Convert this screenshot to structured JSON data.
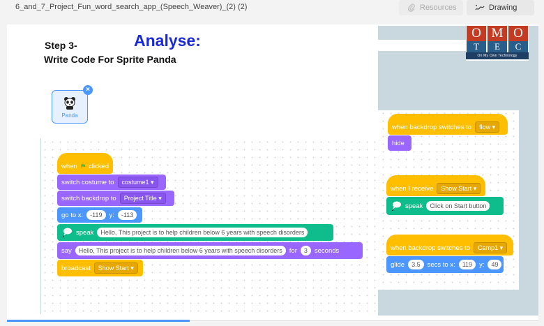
{
  "header": {
    "doc_title": "6_and_7_Project_Fun_word_search_app_(Speech_Weaver)_(2) (2)",
    "resources_label": "Resources",
    "drawing_label": "Drawing"
  },
  "slide": {
    "step": "Step 3-",
    "subtitle": "Write Code For Sprite Panda",
    "heading": "Analyse:",
    "logo": {
      "letters_top": [
        "O",
        "M",
        "O"
      ],
      "letters_bottom": [
        "T",
        "E",
        "C"
      ],
      "tagline": "On My Own Technology"
    },
    "sprite": {
      "name": "Panda",
      "close_symbol": "×"
    },
    "script_main": {
      "when_text": "when",
      "clicked_text": "clicked",
      "switch_costume_label": "switch costume to",
      "costume_value": "costume1 ▾",
      "switch_backdrop_label": "switch backdrop to",
      "backdrop_value": "Project Title ▾",
      "goto_label": "go to x:",
      "goto_x": "-119",
      "goto_y_label": "y:",
      "goto_y": "-113",
      "speak_label": "speak",
      "speak_text": "Hello, This project is to help children below 6 years with speech disorders",
      "say_label": "say",
      "say_text": "Hello, This project is to help children below 6 years with speech disorders",
      "for_label": "for",
      "say_secs": "3",
      "seconds_label": "seconds",
      "broadcast_label": "broadcast",
      "broadcast_value": "Show Start ▾"
    },
    "script_flow": {
      "hat_label": "when backdrop switches to",
      "hat_value": "flow ▾",
      "hide_label": "hide"
    },
    "script_receive": {
      "hat_label": "when I receive",
      "hat_value": "Show Start ▾",
      "speak_label": "speak",
      "speak_text": "Click on Start button"
    },
    "script_camp": {
      "hat_label": "when backdrop switches to",
      "hat_value": "Camp1 ▾",
      "glide_label": "glide",
      "glide_secs": "3.5",
      "secs_label": "secs to x:",
      "glide_x": "119",
      "glide_y_label": "y:",
      "glide_y": "49"
    }
  },
  "colors": {
    "events": "#ffbf00",
    "looks": "#9966ff",
    "motion": "#4c97ff",
    "text_to_speech": "#0fbd8c",
    "heading": "#1a2ad8",
    "logo_red": "#c33b22",
    "logo_blue": "#2a5e8a"
  },
  "icons": [
    "paperclip-icon",
    "drawing-icon",
    "green-flag-icon",
    "speaker-icon",
    "panda-icon",
    "close-icon"
  ]
}
